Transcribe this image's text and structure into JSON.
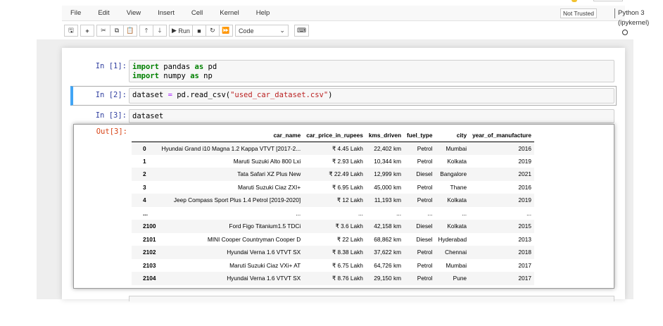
{
  "menu": [
    "File",
    "Edit",
    "View",
    "Insert",
    "Cell",
    "Kernel",
    "Help"
  ],
  "trusted": "Not Trusted",
  "kernel": "Python 3 (ipykernel)",
  "toolbar": {
    "run": "Run",
    "cell_type": "Code"
  },
  "cells": [
    {
      "prompt": "In [1]:"
    },
    {
      "prompt": "In [2]:"
    },
    {
      "prompt": "In [3]:",
      "out_prompt": "Out[3]:",
      "code": "dataset"
    }
  ],
  "code1": {
    "l1a": "import",
    "l1b": " pandas ",
    "l1c": "as",
    "l1d": " pd",
    "l2a": "import",
    "l2b": " numpy ",
    "l2c": "as",
    "l2d": " np"
  },
  "code2": {
    "a": "dataset ",
    "b": "=",
    "c": " pd.read_csv(",
    "d": "\"used_car_dataset.csv\"",
    "e": ")"
  },
  "table": {
    "columns": [
      "",
      "car_name",
      "car_price_in_rupees",
      "kms_driven",
      "fuel_type",
      "city",
      "year_of_manufacture"
    ],
    "rows": [
      [
        "0",
        "Hyundai Grand i10 Magna 1.2 Kappa VTVT [2017-2...",
        "₹ 4.45 Lakh",
        "22,402 km",
        "Petrol",
        "Mumbai",
        "2016"
      ],
      [
        "1",
        "Maruti Suzuki Alto 800 Lxi",
        "₹ 2.93 Lakh",
        "10,344 km",
        "Petrol",
        "Kolkata",
        "2019"
      ],
      [
        "2",
        "Tata Safari XZ Plus New",
        "₹ 22.49 Lakh",
        "12,999 km",
        "Diesel",
        "Bangalore",
        "2021"
      ],
      [
        "3",
        "Maruti Suzuki Ciaz ZXI+",
        "₹ 6.95 Lakh",
        "45,000 km",
        "Petrol",
        "Thane",
        "2016"
      ],
      [
        "4",
        "Jeep Compass Sport Plus 1.4 Petrol [2019-2020]",
        "₹ 12 Lakh",
        "11,193 km",
        "Petrol",
        "Kolkata",
        "2019"
      ],
      [
        "...",
        "...",
        "...",
        "...",
        "...",
        "...",
        "..."
      ],
      [
        "2100",
        "Ford Figo Titanium1.5 TDCi",
        "₹ 3.6 Lakh",
        "42,158 km",
        "Diesel",
        "Kolkata",
        "2015"
      ],
      [
        "2101",
        "MINI Cooper Countryman Cooper D",
        "₹ 22 Lakh",
        "68,862 km",
        "Diesel",
        "Hyderabad",
        "2013"
      ],
      [
        "2102",
        "Hyundai Verna 1.6 VTVT SX",
        "₹ 8.38 Lakh",
        "37,622 km",
        "Petrol",
        "Chennai",
        "2018"
      ],
      [
        "2103",
        "Maruti Suzuki Ciaz VXi+ AT",
        "₹ 6.75 Lakh",
        "64,726 km",
        "Petrol",
        "Mumbai",
        "2017"
      ],
      [
        "2104",
        "Hyundai Verna 1.6 VTVT SX",
        "₹ 8.76 Lakh",
        "29,150 km",
        "Petrol",
        "Pune",
        "2017"
      ]
    ]
  }
}
